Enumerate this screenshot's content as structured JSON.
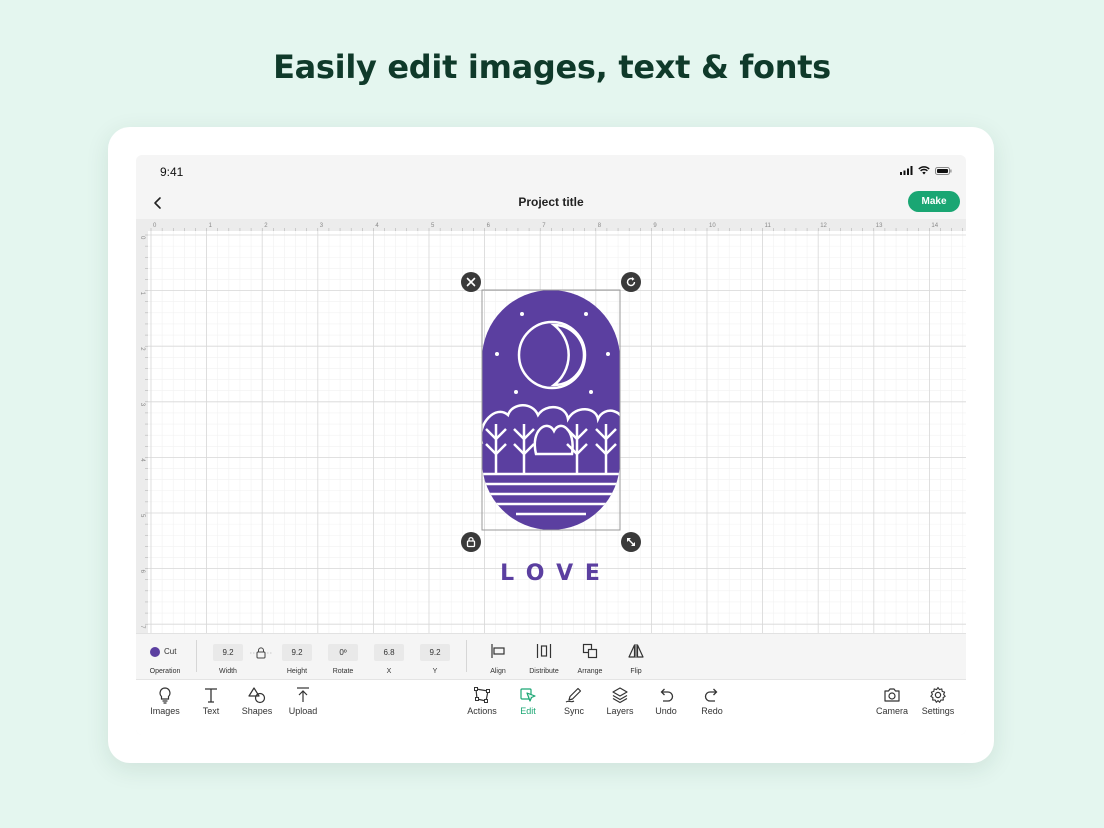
{
  "headline": "Easily edit images, text & fonts",
  "status": {
    "time": "9:41"
  },
  "nav": {
    "title": "Project title",
    "make_label": "Make"
  },
  "ruler": {
    "top_ticks": [
      "0",
      "1",
      "2",
      "3",
      "4",
      "5",
      "6",
      "7",
      "8",
      "9",
      "10",
      "11",
      "12",
      "13",
      "14"
    ],
    "left_ticks": [
      "0",
      "1",
      "2",
      "3",
      "4",
      "5",
      "6",
      "7"
    ]
  },
  "design": {
    "text": "L O V E",
    "color": "#5b3fa0"
  },
  "toolbar": {
    "operation_value": "Cut",
    "operation_label": "Operation",
    "operation_color": "#5b3fa0",
    "width_value": "9.2",
    "width_label": "Width",
    "height_value": "9.2",
    "height_label": "Height",
    "rotate_value": "0º",
    "rotate_label": "Rotate",
    "x_value": "6.8",
    "x_label": "X",
    "y_value": "9.2",
    "y_label": "Y",
    "align_label": "Align",
    "distribute_label": "Distribute",
    "arrange_label": "Arrange",
    "flip_label": "Flip"
  },
  "bottom": {
    "images": "Images",
    "text": "Text",
    "shapes": "Shapes",
    "upload": "Upload",
    "actions": "Actions",
    "edit": "Edit",
    "sync": "Sync",
    "layers": "Layers",
    "undo": "Undo",
    "redo": "Redo",
    "camera": "Camera",
    "settings": "Settings"
  },
  "colors": {
    "accent": "#1aa673",
    "purple": "#5b3fa0",
    "headline": "#0f3a2a"
  }
}
